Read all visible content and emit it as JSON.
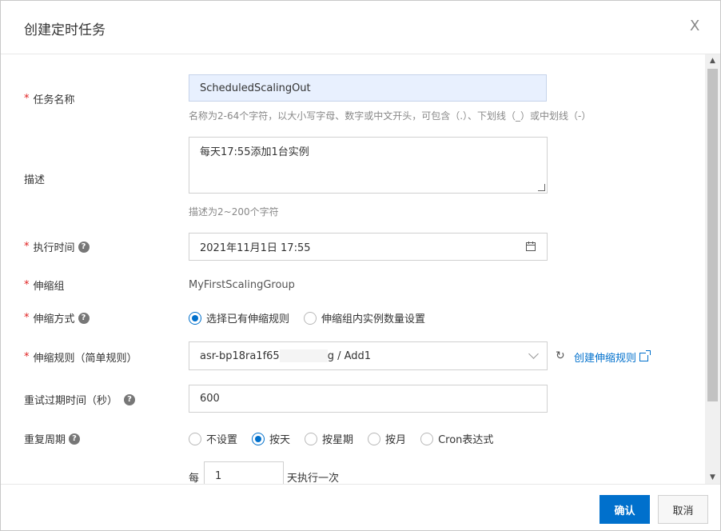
{
  "dialog": {
    "title": "创建定时任务",
    "close": "X"
  },
  "form": {
    "name": {
      "label": "任务名称",
      "value": "ScheduledScalingOut",
      "hint": "名称为2-64个字符，以大小写字母、数字或中文开头，可包含（.）、下划线（_）或中划线（-）"
    },
    "desc": {
      "label": "描述",
      "value": "每天17:55添加1台实例",
      "hint": "描述为2~200个字符"
    },
    "exec_time": {
      "label": "执行时间",
      "value": "2021年11月1日 17:55"
    },
    "group": {
      "label": "伸缩组",
      "value": "MyFirstScalingGroup"
    },
    "mode": {
      "label": "伸缩方式",
      "options": [
        "选择已有伸缩规则",
        "伸缩组内实例数量设置"
      ],
      "selected": 0
    },
    "rule": {
      "label": "伸缩规则（简单规则）",
      "value_prefix": "asr-bp18ra1f65",
      "value_suffix": "g / Add1",
      "create_link": "创建伸缩规则"
    },
    "retry": {
      "label": "重试过期时间（秒）",
      "value": "600"
    },
    "repeat": {
      "label": "重复周期",
      "options": [
        "不设置",
        "按天",
        "按星期",
        "按月",
        "Cron表达式"
      ],
      "selected": 1,
      "every_prefix": "每",
      "every_value": "1",
      "every_suffix": "天执行一次"
    }
  },
  "footer": {
    "ok": "确认",
    "cancel": "取消"
  },
  "colors": {
    "accent": "#0070cc",
    "required": "#e02020"
  }
}
